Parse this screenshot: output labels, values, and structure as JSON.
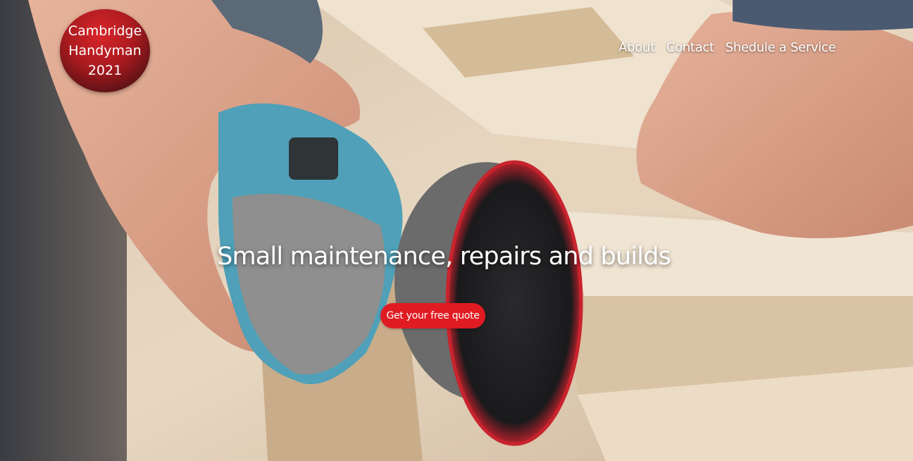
{
  "logo": {
    "line1": "Cambridge",
    "line2": "Handyman",
    "line3": "2021"
  },
  "nav": {
    "items": [
      {
        "label": "About"
      },
      {
        "label": "Contact"
      },
      {
        "label": "Shedule a Service"
      }
    ]
  },
  "hero": {
    "headline": "Small maintenance, repairs and builds",
    "cta_label": "Get your free quote"
  },
  "colors": {
    "accent": "#e01b22",
    "logo_dark": "#2a0d10",
    "text": "#ffffff"
  }
}
